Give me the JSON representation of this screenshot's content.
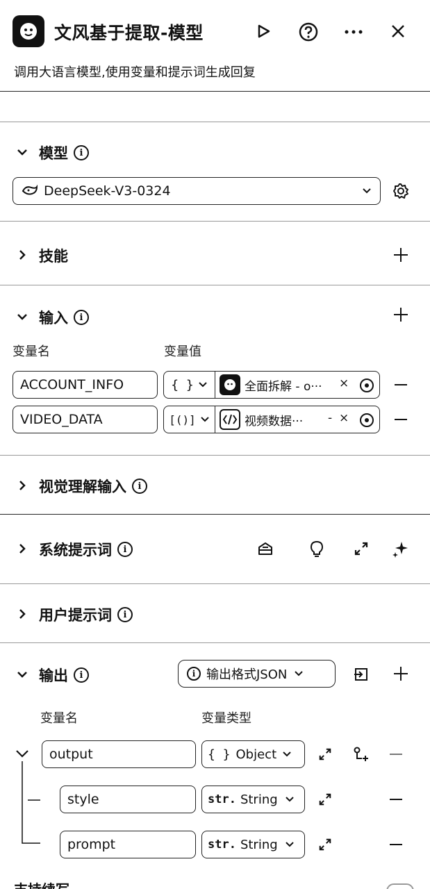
{
  "header": {
    "title": "文风基于提取-模型",
    "subtitle": "调用大语言模型,使用变量和提示词生成回复"
  },
  "model": {
    "section_title": "模型",
    "selected_model": "DeepSeek-V3-0324"
  },
  "skills": {
    "section_title": "技能"
  },
  "input": {
    "section_title": "输入",
    "col_name": "变量名",
    "col_value": "变量值",
    "rows": [
      {
        "name": "ACCOUNT_INFO",
        "type_glyph": "{ }",
        "value": "全面拆解 - o···",
        "close": "×"
      },
      {
        "name": "VIDEO_DATA",
        "type_glyph": "[()]",
        "value": "视频数据···",
        "sep": "-",
        "close": "×"
      }
    ]
  },
  "vision_input": {
    "section_title": "视觉理解输入"
  },
  "system_prompt": {
    "section_title": "系统提示词"
  },
  "user_prompt": {
    "section_title": "用户提示词"
  },
  "output": {
    "section_title": "输出",
    "format_label": "输出格式JSON",
    "col_name": "变量名",
    "col_type": "变量类型",
    "rows": [
      {
        "name": "output",
        "type_prefix": "{ }",
        "type": "Object"
      },
      {
        "name": "style",
        "type_prefix": "str.",
        "type": "String"
      },
      {
        "name": "prompt",
        "type_prefix": "str.",
        "type": "String"
      }
    ]
  },
  "footer": {
    "partial_label": "支持续写"
  }
}
